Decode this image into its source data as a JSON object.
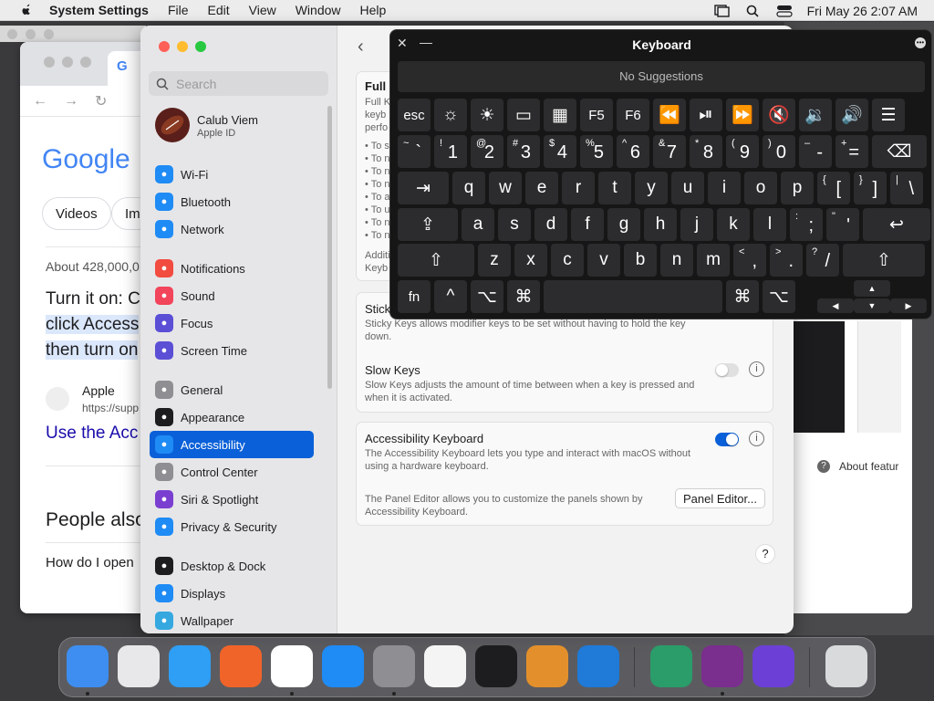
{
  "menubar": {
    "app_name": "System Settings",
    "items": [
      "File",
      "Edit",
      "View",
      "Window",
      "Help"
    ],
    "datetime": "Fri May 26  2:07 AM",
    "icons": [
      "window-icon",
      "search-icon",
      "control-center-icon"
    ]
  },
  "browser": {
    "logo": "Google",
    "pills": [
      "Videos",
      "Im"
    ],
    "result_count": "About 428,000,0",
    "snippet_lines": [
      "Turn it on: C",
      "click Access",
      "then turn on"
    ],
    "source_name": "Apple",
    "source_url": "https://supp",
    "link_title": "Use the Acc",
    "people_also": "People also",
    "question": "How do I open"
  },
  "help_window": {
    "about": "About featur"
  },
  "settings": {
    "search_placeholder": "Search",
    "profile": {
      "name": "Calub Viem",
      "sub": "Apple ID"
    },
    "nav": [
      {
        "label": "Wi-Fi",
        "color": "#1f8bf5",
        "icon": "wifi-icon"
      },
      {
        "label": "Bluetooth",
        "color": "#1f8bf5",
        "icon": "bluetooth-icon"
      },
      {
        "label": "Network",
        "color": "#1f8bf5",
        "icon": "globe-icon"
      },
      {
        "label": "Notifications",
        "color": "#f24b3f",
        "icon": "bell-icon"
      },
      {
        "label": "Sound",
        "color": "#f2445a",
        "icon": "speaker-icon"
      },
      {
        "label": "Focus",
        "color": "#5b4fd6",
        "icon": "moon-icon"
      },
      {
        "label": "Screen Time",
        "color": "#5b4fd6",
        "icon": "hourglass-icon"
      },
      {
        "label": "General",
        "color": "#8e8e93",
        "icon": "gear-icon"
      },
      {
        "label": "Appearance",
        "color": "#1d1d1f",
        "icon": "appearance-icon"
      },
      {
        "label": "Accessibility",
        "color": "#1f8bf5",
        "icon": "accessibility-icon"
      },
      {
        "label": "Control Center",
        "color": "#8e8e93",
        "icon": "toggles-icon"
      },
      {
        "label": "Siri & Spotlight",
        "color": "#7a3fd0",
        "icon": "siri-icon"
      },
      {
        "label": "Privacy & Security",
        "color": "#1f8bf5",
        "icon": "hand-icon"
      },
      {
        "label": "Desktop & Dock",
        "color": "#1d1d1f",
        "icon": "dock-icon"
      },
      {
        "label": "Displays",
        "color": "#1f8bf5",
        "icon": "sun-icon"
      },
      {
        "label": "Wallpaper",
        "color": "#35a8e0",
        "icon": "flower-icon"
      }
    ],
    "selected": "Accessibility",
    "full_card": {
      "title": "Full",
      "lines": [
        "Full K",
        "keyb",
        "perfo"
      ],
      "bullets": [
        "• To s",
        "• To n",
        "• To n",
        "• To n",
        "• To a",
        "• To u",
        "• To n",
        "• To n"
      ],
      "addl": [
        "Additi",
        "Keyb"
      ]
    },
    "sticky": {
      "title": "Stick",
      "desc": "Sticky Keys allows modifier keys to be set without having to hold the key down."
    },
    "slow": {
      "title": "Slow Keys",
      "desc": "Slow Keys adjusts the amount of time between when a key is pressed and when it is activated.",
      "on": false
    },
    "acc_keyboard": {
      "title": "Accessibility Keyboard",
      "desc": "The Accessibility Keyboard lets you type and interact with macOS without using a hardware keyboard.",
      "on": true
    },
    "panel": {
      "desc": "The Panel Editor allows you to customize the panels shown by Accessibility Keyboard.",
      "button": "Panel Editor..."
    },
    "accent": "#0a60d8"
  },
  "keyboard": {
    "title": "Keyboard",
    "suggestions": "No Suggestions",
    "rows": [
      [
        [
          "esc",
          ""
        ],
        [
          "brightness-down-icon",
          "i"
        ],
        [
          "brightness-up-icon",
          "i"
        ],
        [
          "mission-control-icon",
          "i"
        ],
        [
          "launchpad-icon",
          "i"
        ],
        [
          "F5",
          ""
        ],
        [
          "F6",
          ""
        ],
        [
          "rewind-icon",
          "i"
        ],
        [
          "play-pause-icon",
          "i"
        ],
        [
          "fast-forward-icon",
          "i"
        ],
        [
          "mute-icon",
          "i"
        ],
        [
          "volume-down-icon",
          "i"
        ],
        [
          "volume-up-icon",
          "i"
        ],
        [
          "list-icon",
          "i"
        ]
      ],
      [
        [
          "`",
          "~"
        ],
        [
          "1",
          "!"
        ],
        [
          "2",
          "@"
        ],
        [
          "3",
          "#"
        ],
        [
          "4",
          "$"
        ],
        [
          "5",
          "%"
        ],
        [
          "6",
          "^"
        ],
        [
          "7",
          "&"
        ],
        [
          "8",
          "*"
        ],
        [
          "9",
          "("
        ],
        [
          "0",
          ")"
        ],
        [
          "-",
          "–"
        ],
        [
          "=",
          "+"
        ],
        [
          "delete-icon",
          "i"
        ]
      ],
      [
        [
          "tab-icon",
          "i"
        ],
        [
          "q",
          ""
        ],
        [
          "w",
          ""
        ],
        [
          "e",
          ""
        ],
        [
          "r",
          ""
        ],
        [
          "t",
          ""
        ],
        [
          "y",
          ""
        ],
        [
          "u",
          ""
        ],
        [
          "i",
          ""
        ],
        [
          "o",
          ""
        ],
        [
          "p",
          ""
        ],
        [
          "[",
          "{"
        ],
        [
          "]",
          "}"
        ],
        [
          "\\",
          "|"
        ]
      ],
      [
        [
          "caps-lock-icon",
          "i"
        ],
        [
          "a",
          ""
        ],
        [
          "s",
          ""
        ],
        [
          "d",
          ""
        ],
        [
          "f",
          ""
        ],
        [
          "g",
          ""
        ],
        [
          "h",
          ""
        ],
        [
          "j",
          ""
        ],
        [
          "k",
          ""
        ],
        [
          "l",
          ""
        ],
        [
          ";",
          ":"
        ],
        [
          "'",
          "\""
        ],
        [
          "return-icon",
          "i"
        ]
      ],
      [
        [
          "shift-icon",
          "i"
        ],
        [
          "z",
          ""
        ],
        [
          "x",
          ""
        ],
        [
          "c",
          ""
        ],
        [
          "v",
          ""
        ],
        [
          "b",
          ""
        ],
        [
          "n",
          ""
        ],
        [
          "m",
          ""
        ],
        [
          ",",
          "<"
        ],
        [
          ".",
          ">"
        ],
        [
          "/",
          "?"
        ],
        [
          "shift-icon",
          "i"
        ]
      ],
      [
        [
          "fn",
          ""
        ],
        [
          "control-icon",
          "i"
        ],
        [
          "option-icon",
          "i"
        ],
        [
          "command-icon",
          "i"
        ],
        [
          "space-bar",
          "i"
        ],
        [
          "command-icon",
          "i"
        ],
        [
          "option-icon",
          "i"
        ]
      ]
    ],
    "glyphs": {
      "brightness-down-icon": "☼",
      "brightness-up-icon": "☀",
      "mission-control-icon": "▭",
      "launchpad-icon": "▦",
      "rewind-icon": "⏪",
      "play-pause-icon": "⏯",
      "fast-forward-icon": "⏩",
      "mute-icon": "🔇",
      "volume-down-icon": "🔉",
      "volume-up-icon": "🔊",
      "list-icon": "☰",
      "delete-icon": "⌫",
      "tab-icon": "⇥",
      "caps-lock-icon": "⇪",
      "return-icon": "↩",
      "shift-icon": "⇧",
      "control-icon": "^",
      "option-icon": "⌥",
      "command-icon": "⌘",
      "space-bar": ""
    },
    "arrows": [
      "▲",
      "◀",
      "▼",
      "▶"
    ]
  },
  "dock": {
    "apps": [
      {
        "name": "finder-icon",
        "color": "#3d8ef0",
        "running": true
      },
      {
        "name": "launchpad-icon",
        "color": "#e8e8ea",
        "running": false
      },
      {
        "name": "safari-icon",
        "color": "#2f9ef5",
        "running": false
      },
      {
        "name": "firefox-icon",
        "color": "#f0642a",
        "running": false
      },
      {
        "name": "chrome-icon",
        "color": "#ffffff",
        "running": true
      },
      {
        "name": "app-store-icon",
        "color": "#1f8bf5",
        "running": false
      },
      {
        "name": "system-settings-icon",
        "color": "#8e8e93",
        "running": true
      },
      {
        "name": "textedit-icon",
        "color": "#f4f4f4",
        "running": false
      },
      {
        "name": "terminal-icon",
        "color": "#1d1d1f",
        "running": false
      },
      {
        "name": "garageband-icon",
        "color": "#e3902c",
        "running": false
      },
      {
        "name": "vscode-icon",
        "color": "#1f7ad8",
        "running": false
      },
      {
        "name": "robot-app-icon",
        "color": "#2a9d6a",
        "running": false
      },
      {
        "name": "infinity-app-icon",
        "color": "#7a2e8e",
        "running": true
      },
      {
        "name": "purple-app-icon",
        "color": "#6c3fd6",
        "running": false
      },
      {
        "name": "trash-icon",
        "color": "#d8dadc",
        "running": false
      }
    ]
  }
}
